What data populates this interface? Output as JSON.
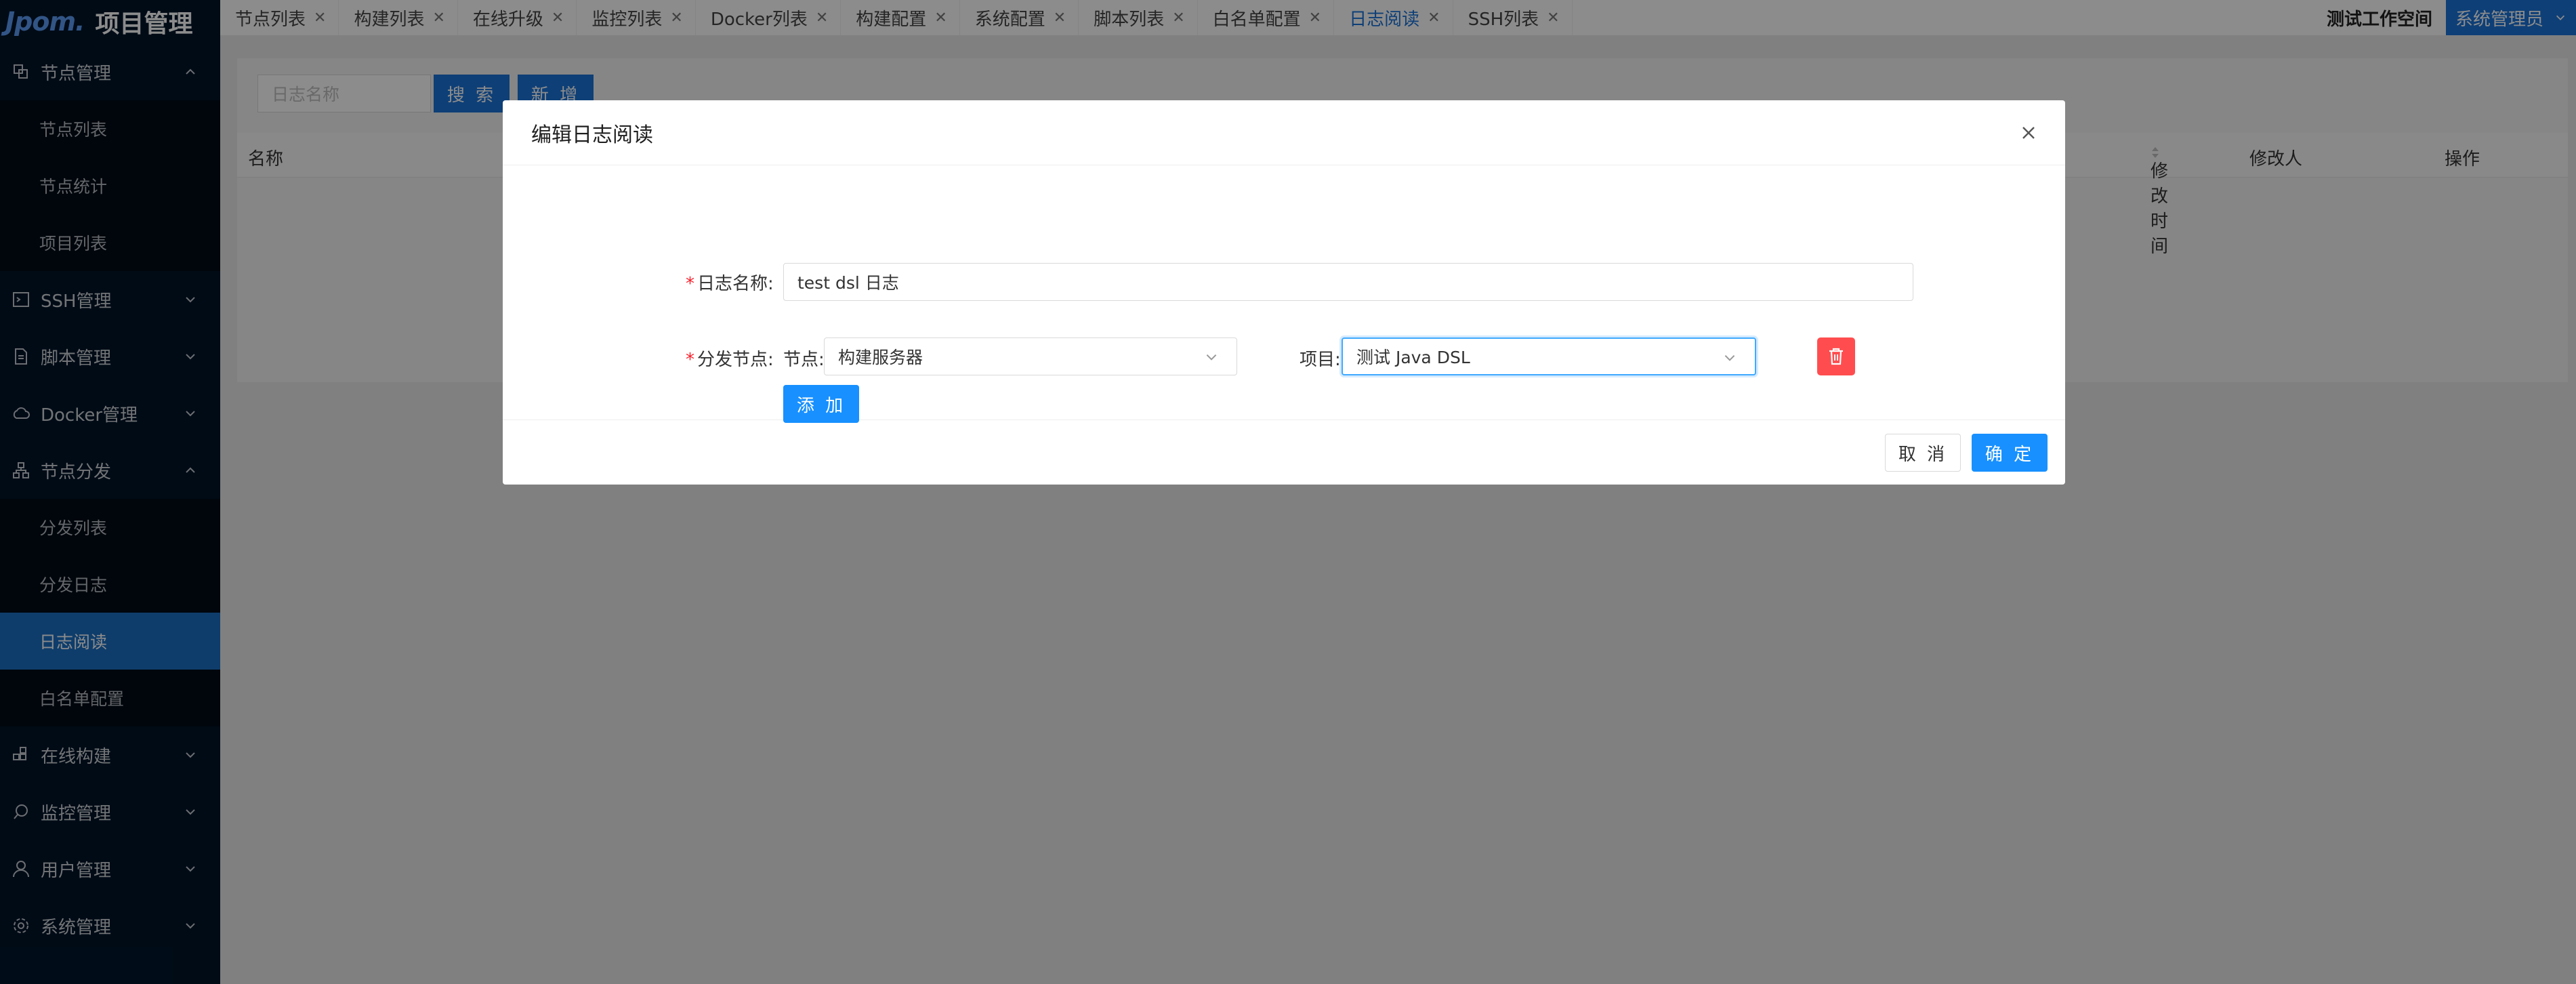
{
  "app": {
    "logo_text": "Jpom.",
    "title": "项目管理"
  },
  "sidebar": {
    "groups": [
      {
        "label": "节点管理",
        "icon": "cluster-icon",
        "expanded": true,
        "items": [
          {
            "label": "节点列表"
          },
          {
            "label": "节点统计"
          },
          {
            "label": "项目列表"
          }
        ]
      },
      {
        "label": "SSH管理",
        "icon": "terminal-icon",
        "expanded": false
      },
      {
        "label": "脚本管理",
        "icon": "file-icon",
        "expanded": false
      },
      {
        "label": "Docker管理",
        "icon": "cloud-icon",
        "expanded": false
      },
      {
        "label": "节点分发",
        "icon": "apartment-icon",
        "expanded": true,
        "items": [
          {
            "label": "分发列表"
          },
          {
            "label": "分发日志"
          },
          {
            "label": "日志阅读",
            "active": true
          },
          {
            "label": "白名单配置"
          }
        ]
      },
      {
        "label": "在线构建",
        "icon": "build-icon",
        "expanded": false
      },
      {
        "label": "监控管理",
        "icon": "monitor-icon",
        "expanded": false
      },
      {
        "label": "用户管理",
        "icon": "user-icon",
        "expanded": false
      },
      {
        "label": "系统管理",
        "icon": "setting-icon",
        "expanded": false
      }
    ]
  },
  "tabs": [
    {
      "label": "节点列表"
    },
    {
      "label": "构建列表"
    },
    {
      "label": "在线升级"
    },
    {
      "label": "监控列表"
    },
    {
      "label": "Docker列表"
    },
    {
      "label": "构建配置"
    },
    {
      "label": "系统配置"
    },
    {
      "label": "脚本列表"
    },
    {
      "label": "白名单配置"
    },
    {
      "label": "日志阅读",
      "active": true
    },
    {
      "label": "SSH列表"
    }
  ],
  "header": {
    "workspace": "测试工作空间",
    "user": "系统管理员"
  },
  "toolbar": {
    "search_placeholder": "日志名称",
    "search_label": "搜 索",
    "add_label": "新 增"
  },
  "table": {
    "columns": [
      "名称",
      "修改人",
      "修改时间",
      "操作"
    ]
  },
  "modal": {
    "title": "编辑日志阅读",
    "name_label": "日志名称:",
    "name_value": "test dsl 日志",
    "dist_label": "分发节点:",
    "node_label": "节点:",
    "node_value": "构建服务器",
    "project_label": "项目:",
    "project_value": "测试 Java DSL",
    "add_label": "添 加",
    "cancel_label": "取 消",
    "ok_label": "确 定"
  },
  "colors": {
    "primary": "#1890ff",
    "danger": "#ff4d4f",
    "sidebar_bg": "#001529",
    "active_menu": "#1a6fc4"
  }
}
